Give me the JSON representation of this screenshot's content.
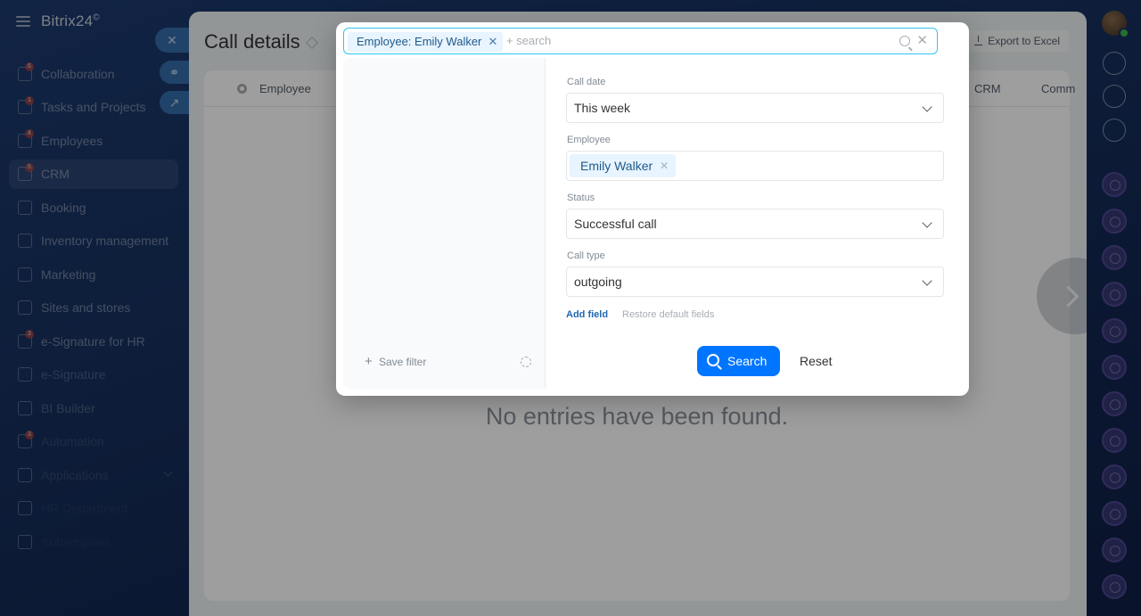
{
  "app": {
    "logo": "Bitrix24",
    "logo_mark": "©"
  },
  "sidebar": {
    "items": [
      {
        "label": "Collaboration",
        "badge": "6",
        "icon": "collaboration-icon"
      },
      {
        "label": "Tasks and Projects",
        "badge": "1",
        "icon": "tasks-icon"
      },
      {
        "label": "Employees",
        "badge": "4",
        "icon": "employees-icon"
      },
      {
        "label": "CRM",
        "badge": "5",
        "icon": "crm-icon"
      },
      {
        "label": "Booking",
        "badge": "",
        "icon": "booking-icon"
      },
      {
        "label": "Inventory management",
        "badge": "",
        "icon": "inventory-icon"
      },
      {
        "label": "Marketing",
        "badge": "",
        "icon": "marketing-icon"
      },
      {
        "label": "Sites and stores",
        "badge": "",
        "icon": "cart-icon"
      },
      {
        "label": "e-Signature for HR",
        "badge": "3",
        "icon": "signature-hr-icon"
      },
      {
        "label": "e-Signature",
        "badge": "",
        "icon": "signature-icon"
      },
      {
        "label": "BI Builder",
        "badge": "",
        "icon": "bi-icon"
      },
      {
        "label": "Automation",
        "badge": "3",
        "icon": "automation-icon"
      },
      {
        "label": "Applications",
        "badge": "",
        "icon": "applications-icon"
      },
      {
        "label": "HR Department",
        "badge": "",
        "icon": "hr-icon"
      },
      {
        "label": "Subscription",
        "badge": "",
        "icon": "subscription-icon"
      }
    ]
  },
  "page": {
    "title": "Call details",
    "export_label": "Export to Excel",
    "grid_columns": [
      "Employee",
      "CRM",
      "Comm"
    ],
    "empty_message": "No entries have been found."
  },
  "filter": {
    "search_chip": "Employee: Emily Walker",
    "search_placeholder": "+ search",
    "save_filter_label": "Save filter",
    "fields": {
      "call_date": {
        "label": "Call date",
        "value": "This week"
      },
      "employee": {
        "label": "Employee",
        "value": "Emily Walker"
      },
      "status": {
        "label": "Status",
        "value": "Successful call"
      },
      "call_type": {
        "label": "Call type",
        "value": "outgoing"
      }
    },
    "add_field_label": "Add field",
    "restore_label": "Restore default fields",
    "search_button": "Search",
    "reset_button": "Reset"
  },
  "colors": {
    "accent": "#0075ff",
    "search_border": "#2fc6f6",
    "chip_bg": "#e8f4ff"
  }
}
